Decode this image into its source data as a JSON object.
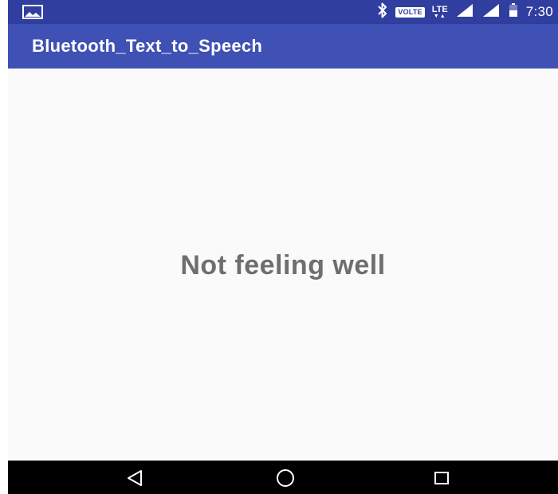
{
  "status_bar": {
    "time": "7:30",
    "volte_label": "VOLTE",
    "lte_label": "LTE",
    "icons": [
      "image-icon",
      "bluetooth-icon",
      "volte-icon",
      "lte-icon",
      "signal-icon",
      "signal-icon",
      "battery-icon"
    ]
  },
  "app_bar": {
    "title": "Bluetooth_Text_to_Speech"
  },
  "main": {
    "message": "Not feeling well"
  },
  "nav_bar": {
    "icons": [
      "back-icon",
      "home-icon",
      "recents-icon"
    ]
  },
  "colors": {
    "status_bar": "#303f9f",
    "app_bar": "#3f51b5",
    "background": "#fafafa",
    "message_text": "#6e6e6e",
    "nav_bar": "#000000"
  }
}
